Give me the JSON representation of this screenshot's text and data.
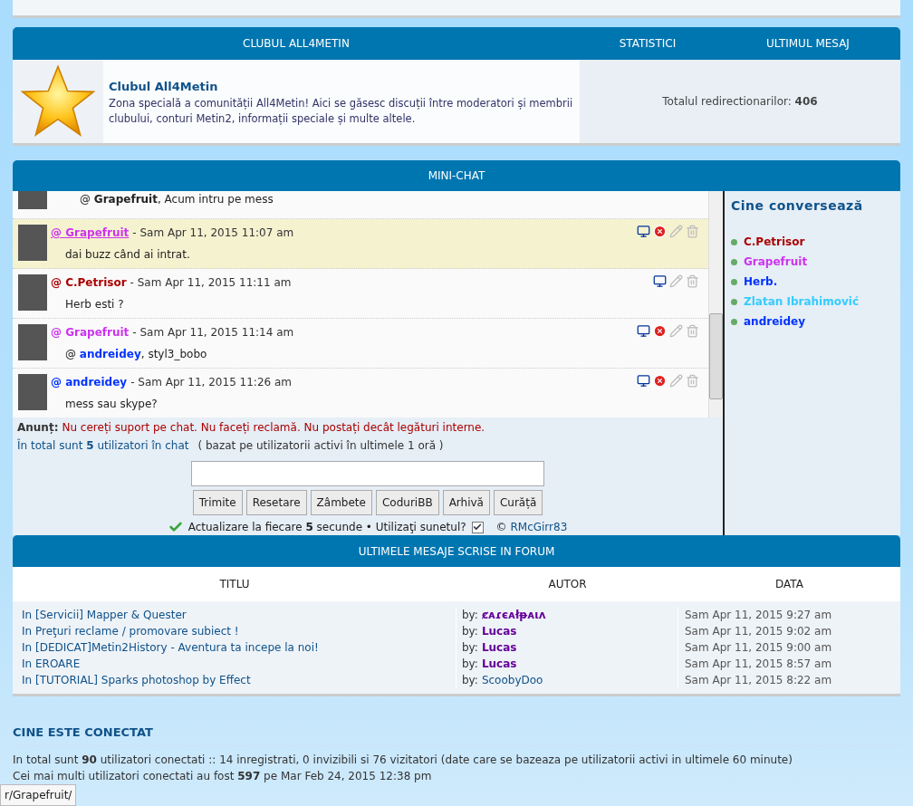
{
  "club_panel": {
    "columns": [
      "CLUBUL ALL4METIN",
      "STATISTICI",
      "ULTIMUL MESAJ"
    ],
    "forum": {
      "title": "Clubul All4Metin",
      "description": "Zona specială a comunității All4Metin! Aici se găsesc discuții între moderatori și membrii clubului, conturi Metin2, informații speciale și multe altele.",
      "stats": "Totalul redirectionarilor: **406**"
    }
  },
  "mini_chat": {
    "title": "MINI-CHAT",
    "messages": [
      {
        "kind": "partial",
        "body": {
          "prefix": "@",
          "mention": {
            "name": "Grapefruit",
            "color": "#222222"
          },
          "rest": ", Acum intru pe mess"
        }
      },
      {
        "kind": "full",
        "user": {
          "name": "@ Grapefruit",
          "color": "#cc33ee",
          "underlined": true
        },
        "time": "- Sam Apr 11, 2015 11:07 am",
        "highlighted": true,
        "can_ban": true,
        "body": {
          "rest": "dai buzz când ai intrat."
        }
      },
      {
        "kind": "full",
        "user": {
          "name": "@ C.Petrisor",
          "color": "#aa0000",
          "underlined": false
        },
        "time": "- Sam Apr 11, 2015 11:11 am",
        "highlighted": false,
        "can_ban": false,
        "body": {
          "rest": "Herb esti ?"
        }
      },
      {
        "kind": "full",
        "user": {
          "name": "@ Grapefruit",
          "color": "#cc33ee",
          "underlined": false
        },
        "time": "- Sam Apr 11, 2015 11:14 am",
        "highlighted": false,
        "can_ban": true,
        "body": {
          "prefix": "@",
          "mention": {
            "name": "andreidey",
            "color": "#0033ff"
          },
          "rest": ", styl3_bobo"
        }
      },
      {
        "kind": "full",
        "user": {
          "name": "@ andreidey",
          "color": "#0033ff",
          "underlined": false
        },
        "time": "- Sam Apr 11, 2015 11:26 am",
        "highlighted": false,
        "can_ban": true,
        "body": {
          "rest": "mess sau skype?"
        }
      }
    ],
    "notice_label": "Anunț:",
    "notice": "Nu cereți suport pe chat. Nu faceți reclamă. Nu postați decât legături interne.",
    "users_count": "În total sunt **5** utilizatori în chat",
    "users_note": "( bazat pe utilizatorii activi în ultimele 1 oră )",
    "buttons": [
      "Trimite",
      "Resetare",
      "Zâmbete",
      "CoduriBB",
      "Arhivă",
      "Curăță"
    ],
    "refresh": "Actualizare la fiecare **5** secunde • Utilizaţi sunetul?",
    "sound": {
      "checked": true
    },
    "copyright": "© ",
    "author": "RMcGirr83",
    "sidebar": {
      "title": "Cine conversează",
      "users": [
        {
          "name": "C.Petrisor",
          "color": "#aa0000"
        },
        {
          "name": "Grapefruit",
          "color": "#cc33ee"
        },
        {
          "name": "Herb.",
          "color": "#0033ff"
        },
        {
          "name": "Zlatan Ibrahimović",
          "color": "#33ccff"
        },
        {
          "name": "andreidey",
          "color": "#0033ff"
        }
      ]
    }
  },
  "latest_posts": {
    "title": "ULTIMELE MESAJE SCRISE IN FORUM",
    "columns": [
      "TITLU",
      "AUTOR",
      "DATA"
    ],
    "rows": [
      {
        "title": "In [Servicii] Mapper & Quester",
        "by": "by:",
        "author": {
          "name": "ȼᴀɾєᴀłᵽᴀιᴧ",
          "color": "#660099",
          "bold": true
        },
        "date": "Sam Apr 11, 2015 9:27 am"
      },
      {
        "title": "In Preţuri reclame / promovare subiect !",
        "by": "by:",
        "author": {
          "name": "Lucas",
          "color": "#660099",
          "bold": true
        },
        "date": "Sam Apr 11, 2015 9:02 am"
      },
      {
        "title": "In [DEDICAT]Metin2History - Aventura ta incepe la noi!",
        "by": "by:",
        "author": {
          "name": "Lucas",
          "color": "#660099",
          "bold": true
        },
        "date": "Sam Apr 11, 2015 9:00 am"
      },
      {
        "title": "In EROARE",
        "by": "by:",
        "author": {
          "name": "Lucas",
          "color": "#660099",
          "bold": true
        },
        "date": "Sam Apr 11, 2015 8:57 am"
      },
      {
        "title": "In [TUTORIAL] Sparks photoshop by Effect",
        "by": "by:",
        "author": {
          "name": "ScoobyDoo",
          "color": "#105289",
          "bold": false
        },
        "date": "Sam Apr 11, 2015 8:22 am"
      }
    ]
  },
  "who_is_online": {
    "title": "CINE ESTE CONECTAT",
    "lines": [
      "In total sunt **90** utilizatori conectati :: 14 inregistrati, 0 invizibili si 76 vizitatori (date care se bazeaza pe utilizatorii activi in ultimele 60 minute)",
      "Cei mai multi utilizatori conectati au fost **597** pe Mar Feb 24, 2015 12:38 pm"
    ]
  },
  "status_bar": {
    "url": "r/Grapefruit/"
  }
}
